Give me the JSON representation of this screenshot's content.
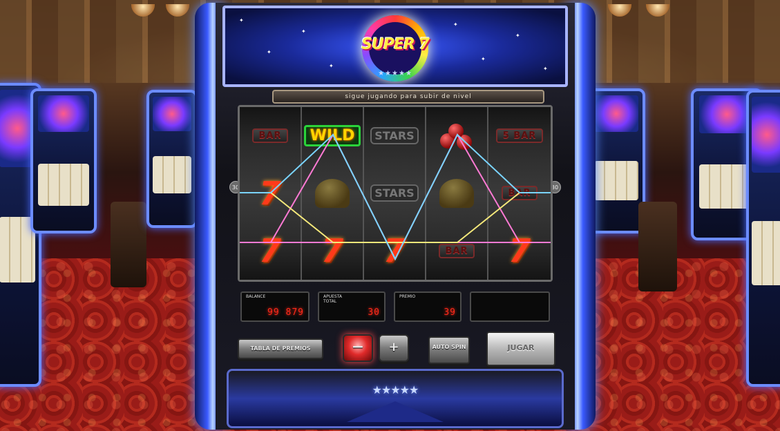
{
  "game": {
    "logo_text": "SUPER 7",
    "logo_stars": "★★★★★",
    "banner": "sigue jugando para subir de nivel",
    "line_left": "30",
    "line_right": "30"
  },
  "reels": [
    [
      "BAR",
      "7",
      "7"
    ],
    [
      "WILD",
      "bell",
      "7"
    ],
    [
      "STARS",
      "STARS",
      "7"
    ],
    [
      "cherry",
      "bell",
      "BAR"
    ],
    [
      "5 BAR",
      "BAR",
      "7"
    ]
  ],
  "meters": {
    "balance_label": "BALANCE",
    "balance_value": "99 879",
    "bet_label": "APUESTA TOTAL",
    "bet_value": "30",
    "prize_label": "PREMIO",
    "prize_value": "39"
  },
  "buttons": {
    "paytable": "TABLA DE PREMIOS",
    "minus": "−",
    "plus": "+",
    "auto_spin": "AUTO SPIN",
    "play": "JUGAR"
  },
  "colors": {
    "accent": "#3a5aff",
    "win_line_pink": "#ff7ad4",
    "win_line_yellow": "#f4e87a",
    "win_line_blue": "#7ad4ff",
    "meter_digits": "#ff2a1a"
  }
}
